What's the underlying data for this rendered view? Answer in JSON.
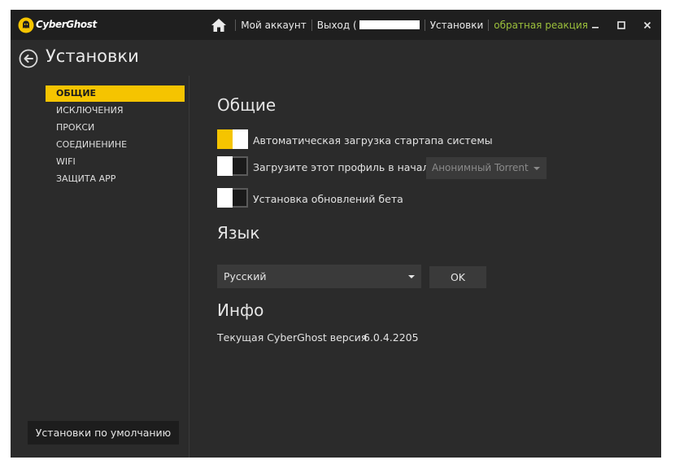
{
  "app": {
    "brand": "CyberGhost"
  },
  "topnav": {
    "account": "Мой аккаунт",
    "logout": "Выход (",
    "settings": "Установки",
    "feedback": "обратная реакция"
  },
  "page": {
    "title": "Установки"
  },
  "sidebar": {
    "items": [
      {
        "label": "ОБЩИЕ",
        "active": true
      },
      {
        "label": "ИСКЛЮЧЕНИЯ",
        "active": false
      },
      {
        "label": "ПРОКСИ",
        "active": false
      },
      {
        "label": "СОЕДИНЕНИНЕ",
        "active": false
      },
      {
        "label": "WIFI",
        "active": false
      },
      {
        "label": "ЗАЩИТА APP",
        "active": false
      }
    ],
    "defaults_button": "Установки по умолчанию"
  },
  "general": {
    "title": "Общие",
    "options": [
      {
        "label": "Автоматическая загрузка стартапа системы",
        "enabled": true
      },
      {
        "label": "Загрузите этот профиль в начале:",
        "enabled": false
      },
      {
        "label": "Установка обновлений бета",
        "enabled": false
      }
    ],
    "profile_select": "Анонимный Torrent"
  },
  "language": {
    "title": "Язык",
    "selected": "Русский",
    "ok_button": "OK"
  },
  "info": {
    "title": "Инфо",
    "version_label": "Текущая CyberGhost версия",
    "version": "6.0.4.2205"
  },
  "colors": {
    "accent": "#f5c400",
    "feedback": "#9bbf3b",
    "background": "#2b2b2b",
    "titlebar": "#1f1f1f"
  },
  "icons": [
    "cyberghost-logo-icon",
    "home-icon",
    "minimize-icon",
    "maximize-icon",
    "close-icon",
    "back-arrow-icon",
    "dropdown-caret-icon"
  ]
}
